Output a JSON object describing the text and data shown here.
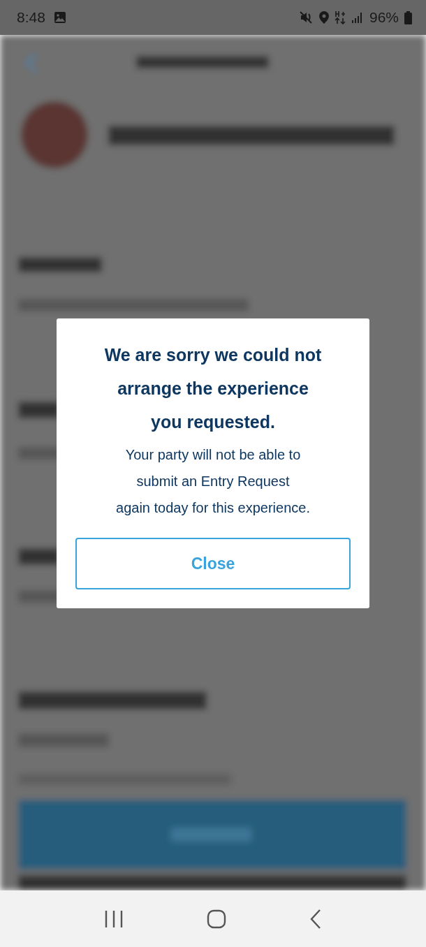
{
  "status_bar": {
    "time": "8:48",
    "battery": "96%"
  },
  "dialog": {
    "title_lines": [
      "We are sorry we could not",
      "arrange the experience",
      "you requested."
    ],
    "message_lines": [
      "Your party will not be able to",
      "submit an Entry Request",
      "again today for this experience."
    ],
    "button": "Close"
  }
}
